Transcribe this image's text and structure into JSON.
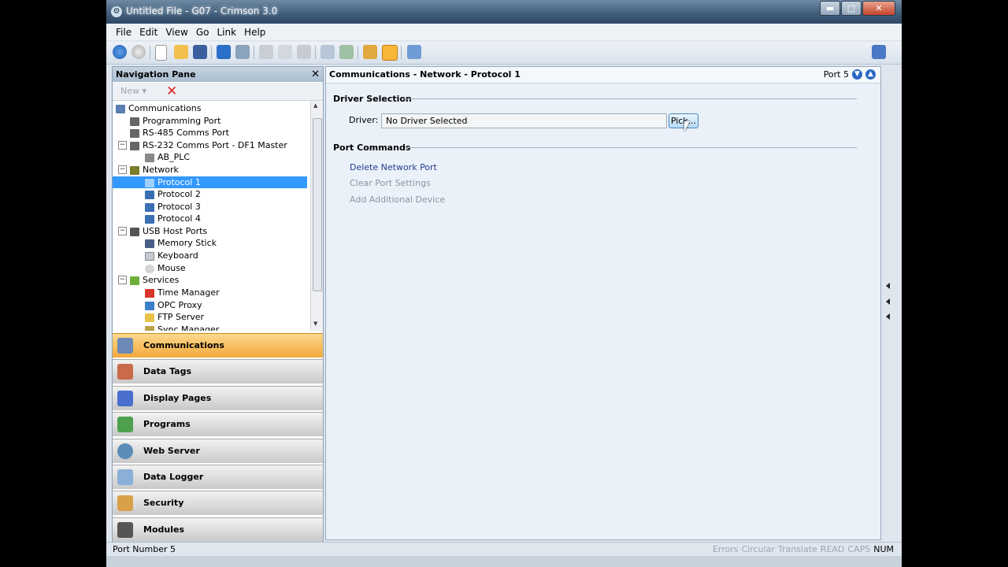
{
  "window": {
    "title": "Untitled File - G07 - Crimson 3.0",
    "minimize": "▬",
    "maximize": "□",
    "close": "✕"
  },
  "menu": [
    "File",
    "Edit",
    "View",
    "Go",
    "Link",
    "Help"
  ],
  "navigation": {
    "header": "Navigation Pane",
    "close": "✕",
    "new_label": "New ▾",
    "delete_symbol": "✕",
    "tree": [
      {
        "label": "Communications",
        "level": 0,
        "icon": "computer-icon",
        "expander": ""
      },
      {
        "label": "Programming Port",
        "level": 1,
        "icon": "port-icon",
        "expander": ""
      },
      {
        "label": "RS-485 Comms Port",
        "level": 1,
        "icon": "port-icon",
        "expander": ""
      },
      {
        "label": "RS-232 Comms Port - DF1 Master",
        "level": 1,
        "icon": "port-icon",
        "expander": "−"
      },
      {
        "label": "AB_PLC",
        "level": 2,
        "icon": "device-icon",
        "expander": ""
      },
      {
        "label": "Network",
        "level": 1,
        "icon": "network-icon",
        "expander": "−"
      },
      {
        "label": "Protocol 1",
        "level": 2,
        "icon": "protocol-icon",
        "expander": "",
        "selected": true
      },
      {
        "label": "Protocol 2",
        "level": 2,
        "icon": "protocol-icon",
        "expander": ""
      },
      {
        "label": "Protocol 3",
        "level": 2,
        "icon": "protocol-icon",
        "expander": ""
      },
      {
        "label": "Protocol 4",
        "level": 2,
        "icon": "protocol-icon",
        "expander": ""
      },
      {
        "label": "USB Host Ports",
        "level": 1,
        "icon": "usb-icon",
        "expander": "−"
      },
      {
        "label": "Memory Stick",
        "level": 2,
        "icon": "memory-stick-icon",
        "expander": ""
      },
      {
        "label": "Keyboard",
        "level": 2,
        "icon": "keyboard-icon",
        "expander": ""
      },
      {
        "label": "Mouse",
        "level": 2,
        "icon": "mouse-icon",
        "expander": ""
      },
      {
        "label": "Services",
        "level": 1,
        "icon": "services-icon",
        "expander": "−"
      },
      {
        "label": "Time Manager",
        "level": 2,
        "icon": "time-manager-icon",
        "expander": ""
      },
      {
        "label": "OPC Proxy",
        "level": 2,
        "icon": "opc-proxy-icon",
        "expander": ""
      },
      {
        "label": "FTP Server",
        "level": 2,
        "icon": "ftp-server-icon",
        "expander": ""
      },
      {
        "label": "Sync Manager",
        "level": 2,
        "icon": "sync-manager-icon",
        "expander": ""
      }
    ],
    "categories": [
      {
        "label": "Communications",
        "icon": "communications-icon",
        "active": true
      },
      {
        "label": "Data Tags",
        "icon": "data-tags-icon"
      },
      {
        "label": "Display Pages",
        "icon": "display-pages-icon"
      },
      {
        "label": "Programs",
        "icon": "programs-icon"
      },
      {
        "label": "Web Server",
        "icon": "web-server-icon"
      },
      {
        "label": "Data Logger",
        "icon": "data-logger-icon"
      },
      {
        "label": "Security",
        "icon": "security-icon"
      },
      {
        "label": "Modules",
        "icon": "modules-icon"
      }
    ]
  },
  "content": {
    "header": "Communications - Network - Protocol 1",
    "port_label": "Port 5",
    "driver_section": "Driver Selection",
    "driver_label": "Driver:",
    "driver_value": "No Driver Selected",
    "pick_button": "Pick...",
    "port_commands_section": "Port Commands",
    "commands": [
      {
        "label": "Delete Network Port",
        "enabled": true
      },
      {
        "label": "Clear Port Settings",
        "enabled": false
      },
      {
        "label": "Add Additional Device",
        "enabled": false
      }
    ]
  },
  "statusbar": {
    "left": "Port Number 5",
    "indicators": [
      {
        "label": "Errors",
        "on": false
      },
      {
        "label": "Circular",
        "on": false
      },
      {
        "label": "Translate",
        "on": false
      },
      {
        "label": "READ",
        "on": false
      },
      {
        "label": "CAPS",
        "on": false
      },
      {
        "label": "NUM",
        "on": true
      }
    ]
  },
  "colors": {
    "selection": "#3399ff",
    "active_category": "#f3a93a",
    "link": "#263d8a"
  }
}
